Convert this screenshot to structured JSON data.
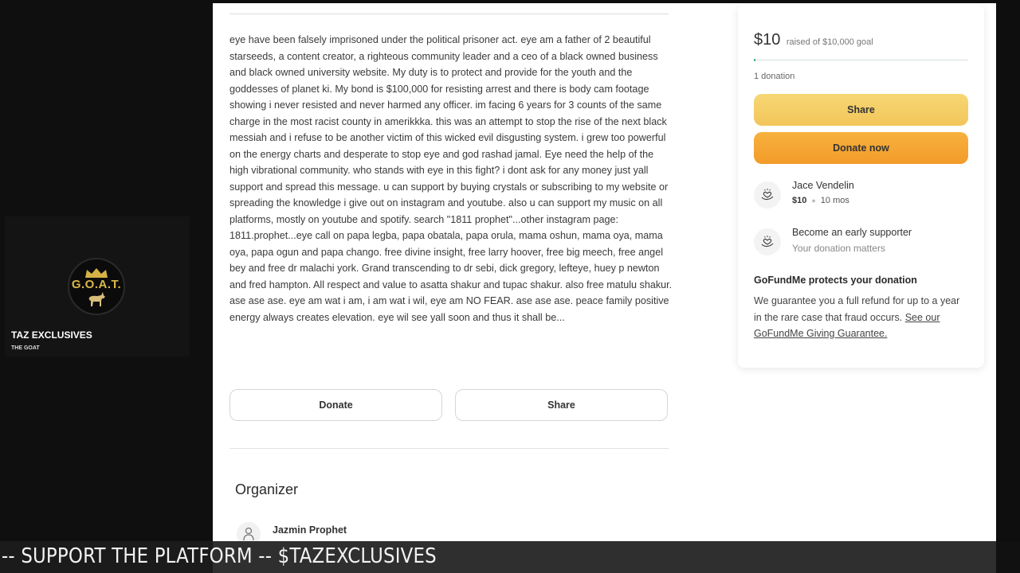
{
  "stream": {
    "channel_name": "TAZ EXCLUSIVES",
    "channel_subtitle": "THE GOAT",
    "logo_text": "G.O.A.T.",
    "ticker_text": "-- SUPPORT THE PLATFORM -- $TAZEXCLUSIVES"
  },
  "campaign": {
    "story": "eye have been falsely imprisoned under the political prisoner act. eye am a father of 2 beautiful starseeds, a content creator, a righteous community leader and a ceo of a black owned business and black owned university website. My duty is to protect and provide for the youth and the goddesses of planet ki. My bond is $100,000 for resisting arrest and there is body cam footage showing i never resisted and never harmed any officer. im facing 6 years for 3 counts of the same charge in the most racist county in amerikkka. this was an attempt to stop the rise of the next black messiah and i refuse to be another victim of this wicked evil disgusting system. i grew too powerful on the energy charts and desperate to stop eye and god rashad jamal. Eye need the help of the high vibrational community. who stands with eye in this fight? i dont ask for any money just yall support and spread this message. u can support by buying crystals or subscribing to my website or spreading the knowledge i give out on instagram and youtube. also u can support my music on all platforms, mostly on youtube and spotify. search \"1811 prophet\"...other instagram page: 1811.prophet...eye call on papa legba, papa obatala, papa orula, mama oshun, mama oya, mama oya, papa ogun and papa chango. free divine insight, free larry hoover, free big meech, free angel bey and free dr malachi york. Grand transcending to dr sebi, dick gregory, lefteye, huey p newton and fred hampton. All respect and value to asatta shakur and tupac shakur. also free matulu shakur. ase ase ase. eye am wat i am, i am wat i wil, eye am NO FEAR. ase ase ase. peace family positive energy always creates elevation. eye wil see yall soon and thus it shall be...",
    "donate_label": "Donate",
    "share_label": "Share",
    "organizer_heading": "Organizer",
    "organizer_name": "Jazmin Prophet"
  },
  "sidebar": {
    "raised_amount": "$10",
    "raised_goal_text": "raised of $10,000 goal",
    "progress_percent": 0.1,
    "donation_count": "1 donation",
    "share_label": "Share",
    "donate_now_label": "Donate now",
    "donors": [
      {
        "name": "Jace Vendelin",
        "amount": "$10",
        "time": "10 mos"
      }
    ],
    "early_supporter": {
      "title": "Become an early supporter",
      "subtitle": "Your donation matters"
    },
    "protect_title": "GoFundMe protects your donation",
    "protect_text": "We guarantee you a full refund for up to a year in the rare case that fraud occurs.",
    "protect_link": "See our GoFundMe Giving Guarantee.",
    "colors": {
      "share_button": "#f4cd66",
      "donate_button": "#f5a634",
      "progress": "#2aa67a"
    }
  }
}
